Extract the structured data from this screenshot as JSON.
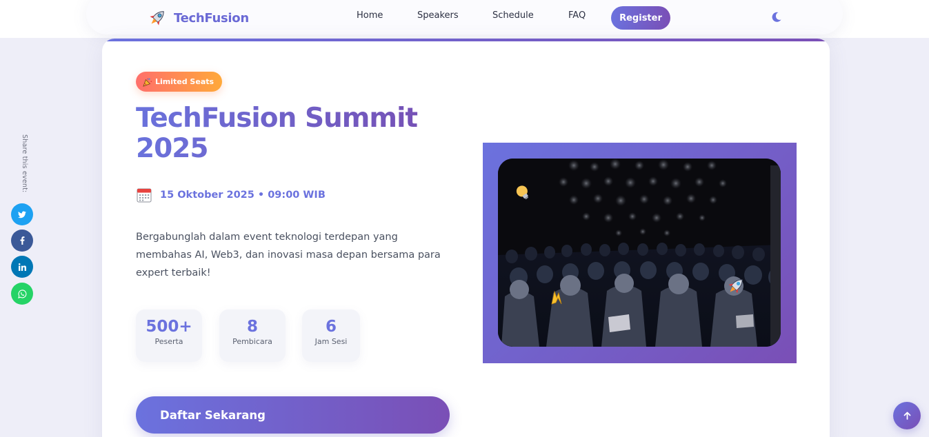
{
  "brand": {
    "name": "TechFusion",
    "icon": "rocket-icon"
  },
  "nav": {
    "links": [
      "Home",
      "Speakers",
      "Schedule",
      "FAQ"
    ],
    "register_label": "Register",
    "theme_icon": "moon-icon"
  },
  "share": {
    "label": "Share this event:",
    "buttons": [
      {
        "icon": "twitter-icon",
        "color": "#1da1f2"
      },
      {
        "icon": "facebook-icon",
        "color": "#3b5998"
      },
      {
        "icon": "linkedin-icon",
        "color": "#0077b5"
      },
      {
        "icon": "whatsapp-icon",
        "color": "#25d366"
      }
    ]
  },
  "hero": {
    "badge": {
      "icon": "party-popper-icon",
      "label": "Limited Seats"
    },
    "title": "TechFusion Summit 2025",
    "date_icon": "calendar-icon",
    "date": "15 Oktober 2025 • 09:00 WIB",
    "description": "Bergabunglah dalam event teknologi terdepan yang membahas AI, Web3, dan inovasi masa depan bersama para expert terbaik!",
    "stats": [
      {
        "value": "500+",
        "label": "Peserta"
      },
      {
        "value": "8",
        "label": "Pembicara"
      },
      {
        "value": "6",
        "label": "Jam Sesi"
      }
    ],
    "cta_label": "Daftar Sekarang"
  },
  "image": {
    "floating_icons": [
      "lightbulb-icon",
      "lightning-icon",
      "rocket-icon"
    ]
  },
  "colors": {
    "accent_start": "#6b72de",
    "accent_end": "#7a4fb6",
    "badge_start": "#ff6f6b",
    "badge_end": "#ffa93a"
  }
}
